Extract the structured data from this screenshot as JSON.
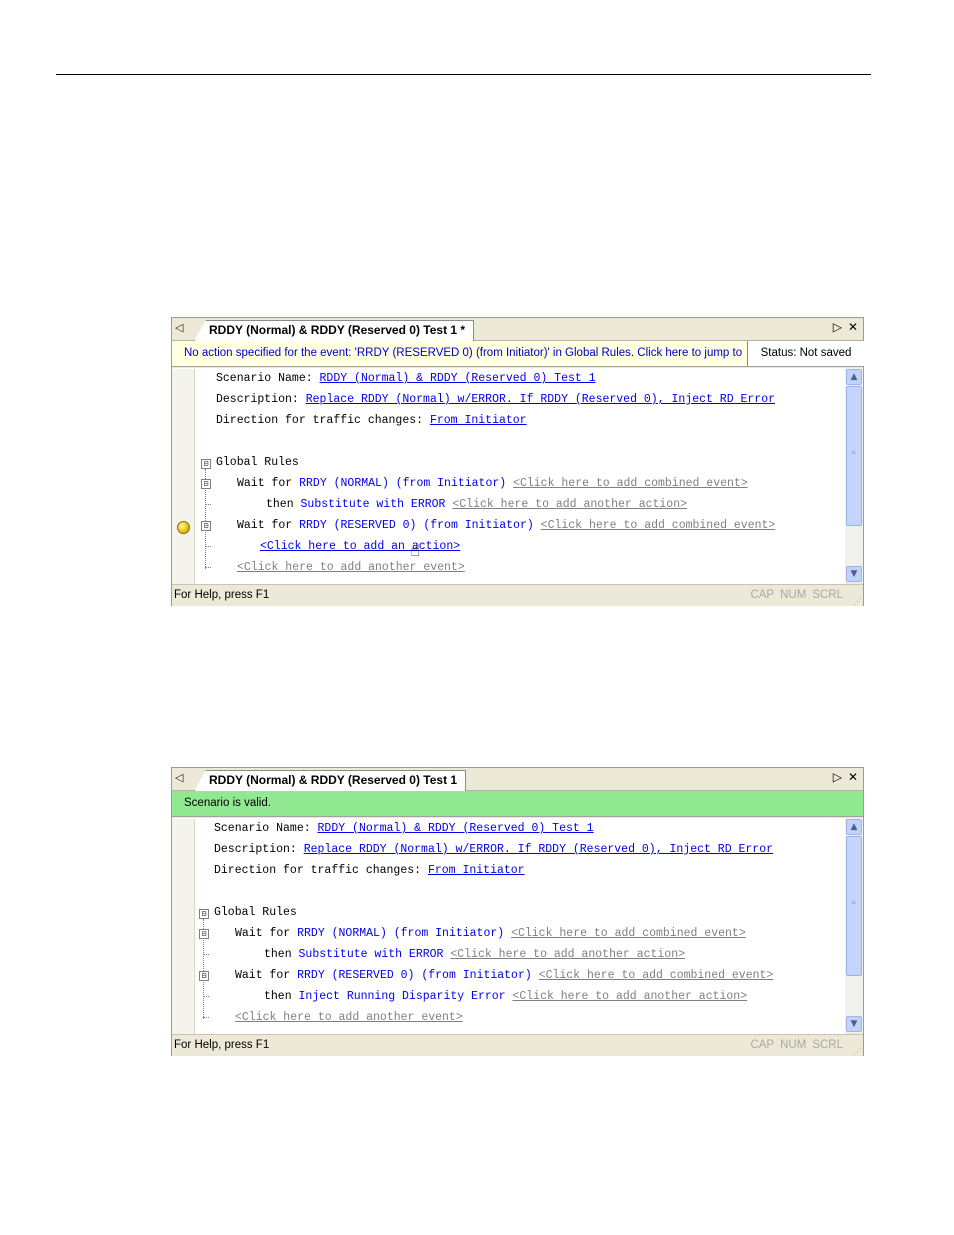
{
  "panels": [
    {
      "tab": {
        "title": "RDDY (Normal) & RDDY (Reserved 0) Test 1 *",
        "close": "✕",
        "right_arrow": "▷",
        "left_arrow": "◁"
      },
      "message": {
        "text": "No action specified for the event: 'RRDY (RESERVED 0) (from Initiator)' in Global Rules.  Click here to jump to t...",
        "status": "Status: Not saved"
      },
      "scenario": {
        "name_label": "Scenario Name:",
        "name_value": "RDDY (Normal) & RDDY (Reserved 0) Test 1",
        "desc_label": "Description:",
        "desc_value": "Replace RDDY (Normal) w/ERROR. If RDDY (Reserved 0), Inject RD Error",
        "dir_label": "Direction for traffic changes:",
        "dir_value": "From Initiator"
      },
      "rules": {
        "header": "Global Rules",
        "r1_wait": "Wait for",
        "r1_event": "RRDY (NORMAL) (from Initiator)",
        "r1_combined": "<Click here to add combined event>",
        "r1_then": "then",
        "r1_action": "Substitute with ERROR",
        "r1_another": "<Click here to add another action>",
        "r2_wait": "Wait for",
        "r2_event": "RRDY (RESERVED 0) (from Initiator)",
        "r2_combined": "<Click here to add combined event>",
        "r2_add_action": "<Click here to add an action>",
        "add_event": "<Click here to add another event>"
      },
      "statusbar": {
        "help": "For Help, press F1",
        "cap": "CAP",
        "num": "NUM",
        "scrl": "SCRL"
      }
    },
    {
      "tab": {
        "title": "RDDY (Normal) & RDDY (Reserved 0) Test 1",
        "close": "✕",
        "right_arrow": "▷",
        "left_arrow": "◁"
      },
      "message": {
        "text": "Scenario is valid."
      },
      "scenario": {
        "name_label": "Scenario Name:",
        "name_value": "RDDY (Normal) & RDDY (Reserved 0) Test 1",
        "desc_label": "Description:",
        "desc_value": "Replace RDDY (Normal) w/ERROR. If RDDY (Reserved 0), Inject RD Error",
        "dir_label": "Direction for traffic changes:",
        "dir_value": "From Initiator"
      },
      "rules": {
        "header": "Global Rules",
        "r1_wait": "Wait for",
        "r1_event": "RRDY (NORMAL) (from Initiator)",
        "r1_combined": "<Click here to add combined event>",
        "r1_then": "then",
        "r1_action": "Substitute with ERROR",
        "r1_another": "<Click here to add another action>",
        "r2_wait": "Wait for",
        "r2_event": "RRDY (RESERVED 0) (from Initiator)",
        "r2_combined": "<Click here to add combined event>",
        "r2_then": "then",
        "r2_action": "Inject Running Disparity Error",
        "r2_another": "<Click here to add another action>",
        "add_event": "<Click here to add another event>"
      },
      "statusbar": {
        "help": "For Help, press F1",
        "cap": "CAP",
        "num": "NUM",
        "scrl": "SCRL"
      }
    }
  ],
  "icons": {
    "collapse": "⊟",
    "scroll_up": "▲",
    "scroll_down": "▼",
    "grip": "≡",
    "hand_cursor": "☝",
    "resize_grip": "⋰"
  },
  "colors": {
    "warning_bg": "#ffffe1",
    "valid_bg": "#90e890",
    "link": "#0000ee",
    "placeholder_link": "#808080"
  }
}
